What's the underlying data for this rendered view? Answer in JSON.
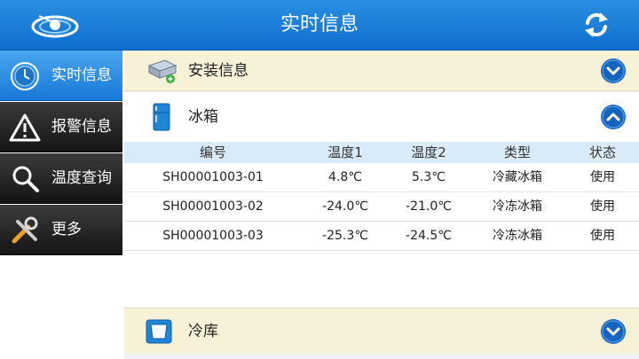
{
  "header": {
    "title": "实时信息",
    "refresh_icon": "refresh-icon",
    "logo_icon": "app-logo"
  },
  "sidebar": {
    "items": [
      {
        "label": "实时信息",
        "icon": "clock-icon",
        "active": true
      },
      {
        "label": "报警信息",
        "icon": "warning-icon",
        "active": false
      },
      {
        "label": "温度查询",
        "icon": "search-icon",
        "active": false
      },
      {
        "label": "更多",
        "icon": "tools-icon",
        "active": false
      }
    ]
  },
  "sections": {
    "install": {
      "label": "安装信息",
      "icon": "hard-drive-icon",
      "expanded": false
    },
    "fridge": {
      "label": "冰箱",
      "icon": "fridge-icon",
      "expanded": true
    },
    "cold_storage": {
      "label": "冷库",
      "icon": "cold-storage-icon",
      "expanded": false
    }
  },
  "fridge_table": {
    "columns": [
      "编号",
      "温度1",
      "温度2",
      "类型",
      "状态"
    ],
    "rows": [
      [
        "SH00001003-01",
        "4.8℃",
        "5.3℃",
        "冷藏冰箱",
        "使用"
      ],
      [
        "SH00001003-02",
        "-24.0℃",
        "-21.0℃",
        "冷冻冰箱",
        "使用"
      ],
      [
        "SH00001003-03",
        "-25.3℃",
        "-24.5℃",
        "冷冻冰箱",
        "使用"
      ]
    ]
  },
  "colors": {
    "topbar": "#1a7fd9",
    "sidebar_active": "#2f8fe5",
    "sidebar_inactive": "#2a2a2a",
    "section_header": "#f6f1d7",
    "table_header": "#d9ebf8",
    "chevron": "#1565c0"
  }
}
